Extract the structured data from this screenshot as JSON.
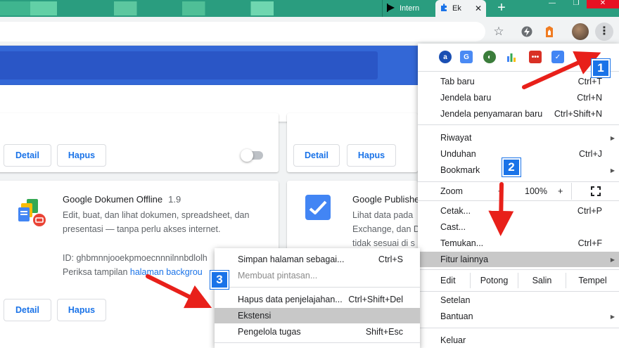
{
  "tabs": {
    "inactive_label": "Intern",
    "active_label": "Ek",
    "close_glyph": "✕",
    "new_tab_glyph": "+"
  },
  "window": {
    "minimize": "—",
    "maximize": "❐",
    "close": "✕"
  },
  "toolbar": {
    "star_glyph": "☆",
    "kebab_glyph": "⋮",
    "icons": [
      "star-icon",
      "lightning-icon",
      "extension-fire-icon",
      "avatar",
      "kebab-menu-icon"
    ]
  },
  "cards": {
    "top_left": {
      "detail": "Detail",
      "hapus": "Hapus"
    },
    "top_right": {
      "detail": "Detail",
      "hapus": "Hapus"
    },
    "docs": {
      "title": "Google Dokumen Offline",
      "version": "1.9",
      "desc1": "Edit, buat, dan lihat dokumen, spreadsheet, dan",
      "desc2": "presentasi — tanpa perlu akses internet.",
      "id_line": "ID: ghbmnnjooekpmoecnnnilnnbdlolh",
      "inspect_prefix": "Periksa tampilan ",
      "inspect_link": "halaman backgrou",
      "detail": "Detail",
      "hapus": "Hapus"
    },
    "publisher": {
      "title": "Google Publishe",
      "desc1": "Lihat data pada",
      "desc2": "Exchange, dan D",
      "desc3": "tidak sesuai di s"
    }
  },
  "main_menu": {
    "items": [
      {
        "label": "Tab baru",
        "shortcut": "Ctrl+T"
      },
      {
        "label": "Jendela baru",
        "shortcut": "Ctrl+N"
      },
      {
        "label": "Jendela penyamaran baru",
        "shortcut": "Ctrl+Shift+N"
      },
      {
        "label": "Riwayat",
        "shortcut": ""
      },
      {
        "label": "Unduhan",
        "shortcut": "Ctrl+J"
      },
      {
        "label": "Bookmark",
        "shortcut": ""
      },
      {
        "label": "Cetak...",
        "shortcut": "Ctrl+P"
      },
      {
        "label": "Cast...",
        "shortcut": ""
      },
      {
        "label": "Temukan...",
        "shortcut": "Ctrl+F"
      },
      {
        "label": "Fitur lainnya",
        "shortcut": ""
      },
      {
        "label": "Setelan",
        "shortcut": ""
      },
      {
        "label": "Bantuan",
        "shortcut": ""
      },
      {
        "label": "Keluar",
        "shortcut": ""
      }
    ],
    "zoom": {
      "label": "Zoom",
      "minus": "−",
      "value": "100%",
      "plus": "+"
    },
    "edit": {
      "label": "Edit",
      "cut": "Potong",
      "copy": "Salin",
      "paste": "Tempel"
    },
    "arrow_glyph": "▶"
  },
  "sub_menu": {
    "items": [
      {
        "label": "Simpan halaman sebagai...",
        "shortcut": "Ctrl+S"
      },
      {
        "label": "Membuat pintasan...",
        "shortcut": ""
      },
      {
        "label": "Hapus data penjelajahan...",
        "shortcut": "Ctrl+Shift+Del"
      },
      {
        "label": "Ekstensi",
        "shortcut": ""
      },
      {
        "label": "Pengelola tugas",
        "shortcut": "Shift+Esc"
      }
    ]
  },
  "annotations": {
    "badge1": "1",
    "badge2": "2",
    "badge3": "3"
  },
  "colors": {
    "accent": "#1a73e8",
    "arrow": "#e8201a",
    "tabstrip": "#2a9d7f",
    "highlight": "#c8c8c8"
  }
}
